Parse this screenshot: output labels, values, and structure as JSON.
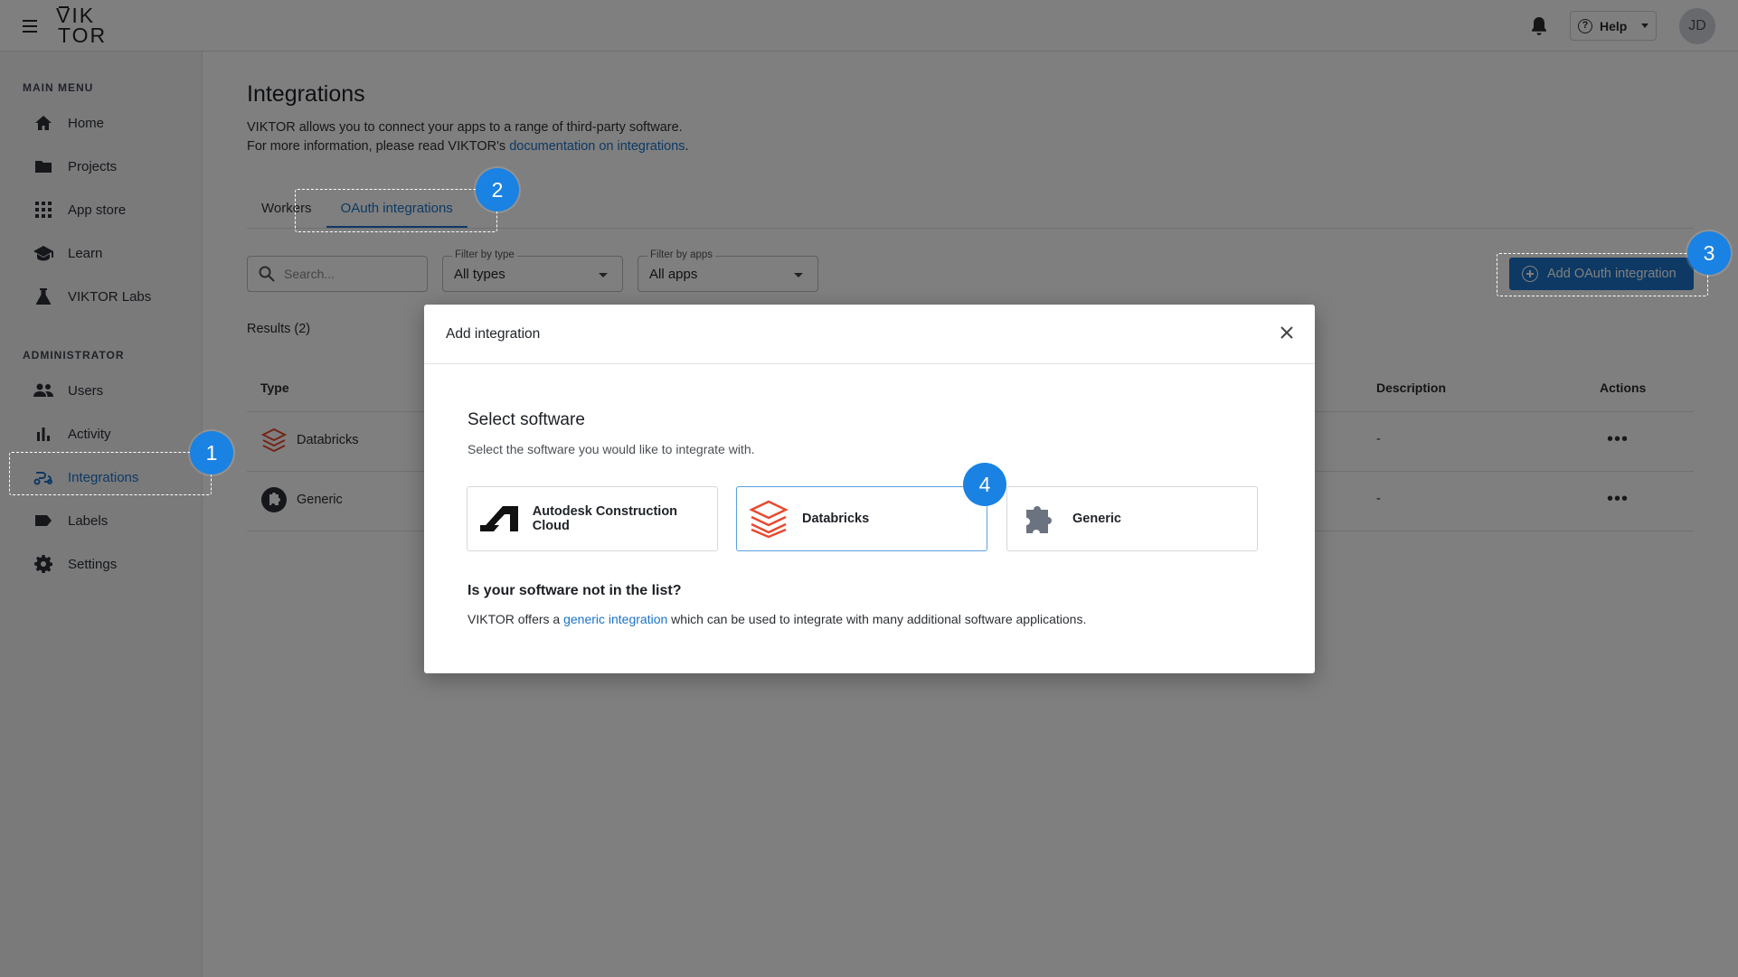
{
  "app": {
    "logo_line1": "VIK",
    "logo_line2": "TOR",
    "help_label": "Help",
    "user_initials": "JD"
  },
  "sidebar": {
    "main_heading": "MAIN MENU",
    "main_items": [
      {
        "label": "Home",
        "icon": "home-icon"
      },
      {
        "label": "Projects",
        "icon": "folder-icon"
      },
      {
        "label": "App store",
        "icon": "grid-icon"
      },
      {
        "label": "Learn",
        "icon": "graduation-cap-icon"
      },
      {
        "label": "VIKTOR Labs",
        "icon": "flask-icon"
      }
    ],
    "admin_heading": "ADMINISTRATOR",
    "admin_items": [
      {
        "label": "Users",
        "icon": "users-icon"
      },
      {
        "label": "Activity",
        "icon": "bar-chart-icon"
      },
      {
        "label": "Integrations",
        "icon": "integrations-icon",
        "active": true
      },
      {
        "label": "Labels",
        "icon": "label-icon"
      },
      {
        "label": "Settings",
        "icon": "gear-icon"
      }
    ]
  },
  "page": {
    "title": "Integrations",
    "intro_line1": "VIKTOR allows you to connect your apps to a range of third-party software.",
    "intro_line2_prefix": "For more information, please read VIKTOR's ",
    "intro_link": "documentation on integrations",
    "intro_line2_suffix": ".",
    "tabs": [
      "Workers",
      "OAuth integrations"
    ],
    "search_placeholder": "Search...",
    "filter_type_label": "Filter by type",
    "filter_type_value": "All types",
    "filter_apps_label": "Filter by apps",
    "filter_apps_value": "All apps",
    "add_button": "Add OAuth integration",
    "results": "Results (2)",
    "table": {
      "headers": {
        "type": "Type",
        "description": "Description",
        "actions": "Actions"
      },
      "rows": [
        {
          "type": "Databricks",
          "description": "-",
          "actions": "•••"
        },
        {
          "type": "Generic",
          "description": "-",
          "actions": "•••"
        }
      ]
    }
  },
  "modal": {
    "title": "Add integration",
    "select_title": "Select software",
    "select_subtitle": "Select the software you would like to integrate with.",
    "cards": [
      {
        "label": "Autodesk Construction Cloud",
        "icon": "autodesk-icon"
      },
      {
        "label": "Databricks",
        "icon": "databricks-icon",
        "selected": true
      },
      {
        "label": "Generic",
        "icon": "puzzle-icon"
      }
    ],
    "not_in_list": "Is your software not in the list?",
    "generic_prefix": "VIKTOR offers a ",
    "generic_link": "generic integration",
    "generic_suffix": " which can be used to integrate with many additional software applications."
  },
  "callouts": [
    "1",
    "2",
    "3",
    "4"
  ],
  "colors": {
    "accent": "#1a73c8",
    "badge": "#1a82e2",
    "overlay": "rgba(0,0,0,0.5)",
    "databricks_red": "#e8482f"
  }
}
